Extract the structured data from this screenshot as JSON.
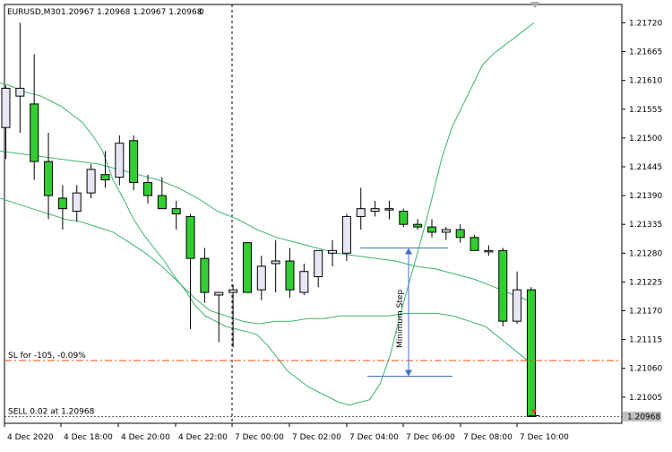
{
  "header": {
    "symbol": "EURUSD,M30",
    "ohlc": "1.20967 1.20968 1.20967 1.20968",
    "extra": "0"
  },
  "colors": {
    "bull_fill": "#e6e6f5",
    "bear_fill": "#32cd32",
    "outline": "#000000",
    "envelope": "#3cb371",
    "sl_line": "#ff4500",
    "arrow_line": "#4472c4",
    "current_price_bg": "#c0c0c0",
    "sell_arrow": "#ff3300"
  },
  "chart_data": {
    "type": "candlestick",
    "symbol": "EURUSD",
    "timeframe": "M30",
    "ylim": [
      1.20955,
      1.21755
    ],
    "y_ticks": [
      "1.21720",
      "1.21665",
      "1.21610",
      "1.21555",
      "1.21500",
      "1.21445",
      "1.21390",
      "1.21335",
      "1.21280",
      "1.21225",
      "1.21170",
      "1.21115",
      "1.21060",
      "1.21005"
    ],
    "x_ticks": [
      "4 Dec 2020",
      "4 Dec 18:00",
      "4 Dec 20:00",
      "4 Dec 22:00",
      "7 Dec 00:00",
      "7 Dec 02:00",
      "7 Dec 04:00",
      "7 Dec 06:00",
      "7 Dec 08:00",
      "7 Dec 10:00"
    ],
    "candles": [
      {
        "o": 1.2152,
        "h": 1.216,
        "l": 1.2146,
        "c": 1.21595
      },
      {
        "o": 1.2158,
        "h": 1.2172,
        "l": 1.2151,
        "c": 1.21595
      },
      {
        "o": 1.21565,
        "h": 1.2166,
        "l": 1.2142,
        "c": 1.21455
      },
      {
        "o": 1.21455,
        "h": 1.2151,
        "l": 1.21345,
        "c": 1.2139
      },
      {
        "o": 1.21385,
        "h": 1.2141,
        "l": 1.21325,
        "c": 1.21365
      },
      {
        "o": 1.2136,
        "h": 1.2141,
        "l": 1.2134,
        "c": 1.21395
      },
      {
        "o": 1.21395,
        "h": 1.2145,
        "l": 1.21385,
        "c": 1.2144
      },
      {
        "o": 1.2143,
        "h": 1.21475,
        "l": 1.21405,
        "c": 1.2142
      },
      {
        "o": 1.21425,
        "h": 1.21505,
        "l": 1.2141,
        "c": 1.2149
      },
      {
        "o": 1.21495,
        "h": 1.21505,
        "l": 1.214,
        "c": 1.21415
      },
      {
        "o": 1.21415,
        "h": 1.2143,
        "l": 1.21375,
        "c": 1.2139
      },
      {
        "o": 1.2139,
        "h": 1.21425,
        "l": 1.21365,
        "c": 1.21365
      },
      {
        "o": 1.21365,
        "h": 1.2138,
        "l": 1.21325,
        "c": 1.21355
      },
      {
        "o": 1.2135,
        "h": 1.21355,
        "l": 1.21135,
        "c": 1.2127
      },
      {
        "o": 1.2127,
        "h": 1.2129,
        "l": 1.21185,
        "c": 1.21205
      },
      {
        "o": 1.212,
        "h": 1.21205,
        "l": 1.2111,
        "c": 1.21205
      },
      {
        "o": 1.21205,
        "h": 1.2122,
        "l": 1.211,
        "c": 1.2121
      },
      {
        "o": 1.213,
        "h": 1.213,
        "l": 1.21205,
        "c": 1.21205
      },
      {
        "o": 1.2121,
        "h": 1.21275,
        "l": 1.2119,
        "c": 1.21255
      },
      {
        "o": 1.2126,
        "h": 1.21305,
        "l": 1.21205,
        "c": 1.21265
      },
      {
        "o": 1.21265,
        "h": 1.2129,
        "l": 1.21195,
        "c": 1.2121
      },
      {
        "o": 1.21205,
        "h": 1.2126,
        "l": 1.212,
        "c": 1.21245
      },
      {
        "o": 1.21235,
        "h": 1.21285,
        "l": 1.21215,
        "c": 1.21285
      },
      {
        "o": 1.2128,
        "h": 1.21305,
        "l": 1.21255,
        "c": 1.21285
      },
      {
        "o": 1.2128,
        "h": 1.21355,
        "l": 1.21265,
        "c": 1.2135
      },
      {
        "o": 1.2135,
        "h": 1.21405,
        "l": 1.21325,
        "c": 1.21365
      },
      {
        "o": 1.2136,
        "h": 1.2138,
        "l": 1.2135,
        "c": 1.21365
      },
      {
        "o": 1.21365,
        "h": 1.2138,
        "l": 1.21345,
        "c": 1.21365
      },
      {
        "o": 1.2136,
        "h": 1.21365,
        "l": 1.2133,
        "c": 1.21335
      },
      {
        "o": 1.21335,
        "h": 1.21345,
        "l": 1.21325,
        "c": 1.2133
      },
      {
        "o": 1.2133,
        "h": 1.21345,
        "l": 1.2131,
        "c": 1.2132
      },
      {
        "o": 1.2132,
        "h": 1.2133,
        "l": 1.21305,
        "c": 1.21325
      },
      {
        "o": 1.21325,
        "h": 1.21335,
        "l": 1.213,
        "c": 1.2131
      },
      {
        "o": 1.2131,
        "h": 1.21315,
        "l": 1.21285,
        "c": 1.21285
      },
      {
        "o": 1.21285,
        "h": 1.21295,
        "l": 1.21275,
        "c": 1.21285
      },
      {
        "o": 1.21285,
        "h": 1.2129,
        "l": 1.2114,
        "c": 1.2115
      },
      {
        "o": 1.2115,
        "h": 1.21245,
        "l": 1.21145,
        "c": 1.2121
      },
      {
        "o": 1.2121,
        "h": 1.21215,
        "l": 1.20967,
        "c": 1.20968
      }
    ],
    "upper_band": [
      1.21605,
      1.216,
      1.2159,
      1.21585,
      1.2158,
      1.2157,
      1.2156,
      1.21545,
      1.2153,
      1.21505,
      1.21475,
      1.2142,
      1.21385,
      1.21345,
      1.21315,
      1.2129,
      1.21265,
      1.21235,
      1.2121,
      1.2118,
      1.2116,
      1.2115,
      1.2114,
      1.21135,
      1.2113,
      1.21125,
      1.21105,
      1.2108,
      1.21055,
      1.2104,
      1.21025,
      1.21015,
      1.21005,
      1.20995,
      1.2099,
      1.20995,
      1.21,
      1.2103,
      1.21085,
      1.21165,
      1.21235,
      1.21305,
      1.2138,
      1.2146,
      1.2152,
      1.2156,
      1.216,
      1.2164,
      1.2166,
      1.21675,
      1.2169,
      1.21705,
      1.2172
    ],
    "mid_band": [
      1.21475,
      1.2147,
      1.21465,
      1.2146,
      1.21455,
      1.2145,
      1.2144,
      1.2143,
      1.2142,
      1.21405,
      1.21385,
      1.2136,
      1.21345,
      1.21325,
      1.2131,
      1.213,
      1.2129,
      1.2128,
      1.21275,
      1.2127,
      1.21265,
      1.21255,
      1.2125,
      1.2124,
      1.2123,
      1.21215,
      1.212,
      1.21185
    ],
    "lower_band": [
      1.21385,
      1.21375,
      1.21365,
      1.21355,
      1.21345,
      1.2134,
      1.2133,
      1.2132,
      1.213,
      1.2128,
      1.21255,
      1.21225,
      1.21195,
      1.2117,
      1.2116,
      1.2115,
      1.21145,
      1.2115,
      1.2115,
      1.21155,
      1.21155,
      1.2116,
      1.2116,
      1.2116,
      1.2116,
      1.21165,
      1.21165,
      1.21165,
      1.2116,
      1.2115,
      1.2114,
      1.21115,
      1.2109,
      1.21065
    ],
    "sl_label": "SL for -105, -0.09%",
    "sl_price": 1.21075,
    "sell_label": "SELL 0.02 at 1.20968",
    "sell_price": 1.20968,
    "current_price_label": "1.20968",
    "annotation": "Minimum Step",
    "min_step_top": 1.2129,
    "min_step_bottom": 1.21045
  }
}
